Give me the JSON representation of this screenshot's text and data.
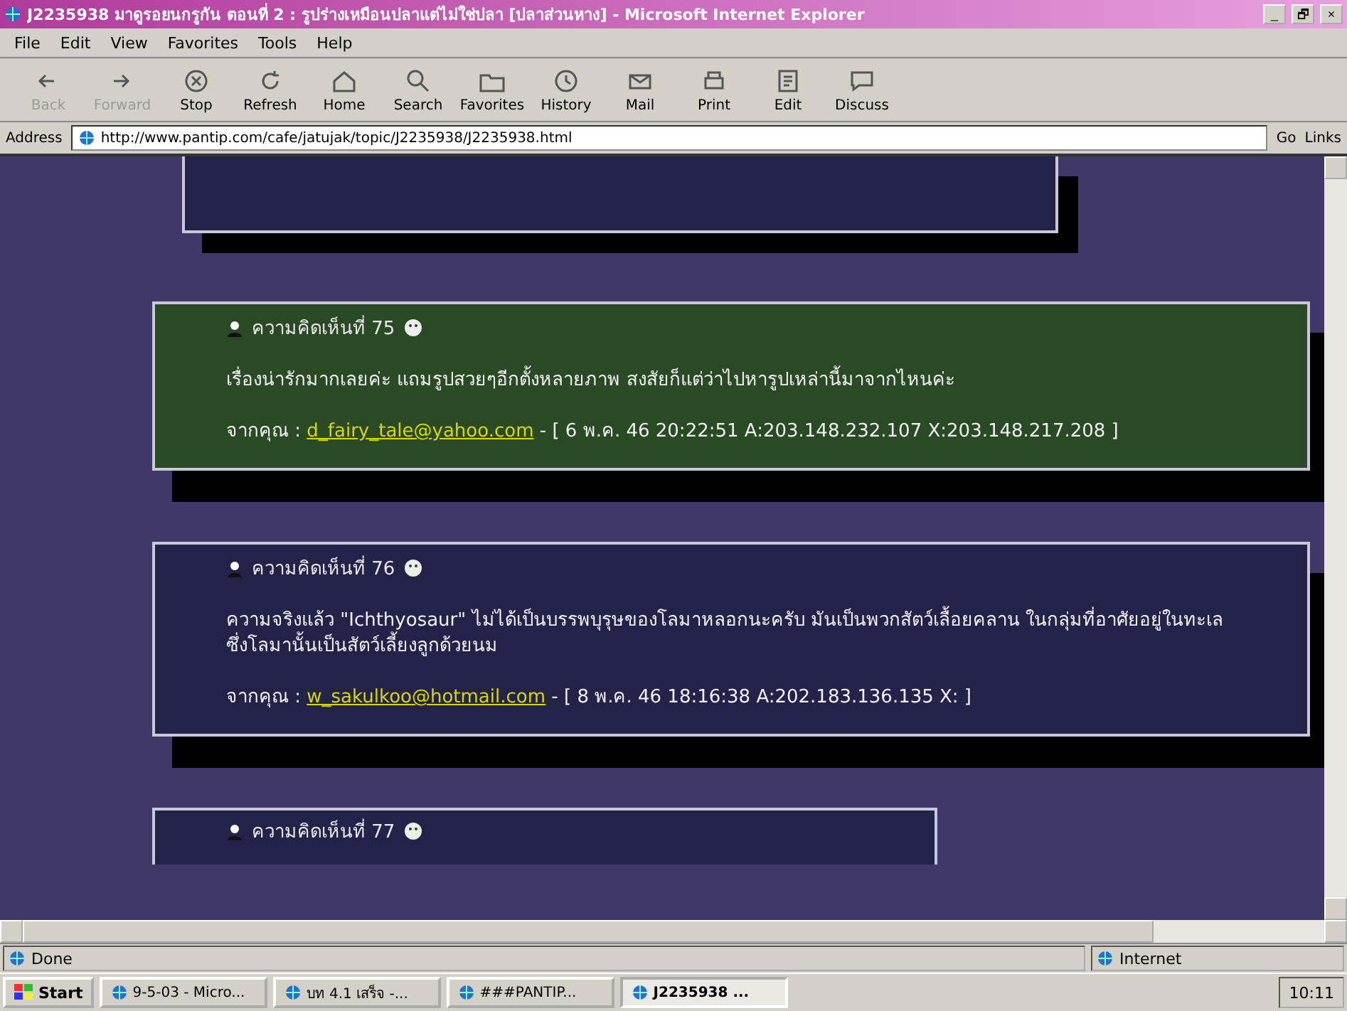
{
  "window": {
    "title": "J2235938 มาดูรอยนกรูกัน ตอนที่ 2 : รูปร่างเหมือนปลาแต่ไม่ใช่ปลา [ปลาส่วนหาง] - Microsoft Internet Explorer",
    "controls": [
      "_",
      "🗗",
      "×"
    ]
  },
  "menu": [
    "File",
    "Edit",
    "View",
    "Favorites",
    "Tools",
    "Help"
  ],
  "toolbar": [
    {
      "label": "Back",
      "kind": "back",
      "disabled": true
    },
    {
      "label": "Forward",
      "kind": "forward",
      "disabled": true
    },
    {
      "label": "Stop",
      "kind": "stop",
      "disabled": false
    },
    {
      "label": "Refresh",
      "kind": "refresh",
      "disabled": false
    },
    {
      "label": "Home",
      "kind": "home",
      "disabled": false
    },
    {
      "label": "Search",
      "kind": "search",
      "disabled": false
    },
    {
      "label": "Favorites",
      "kind": "favorites",
      "disabled": false
    },
    {
      "label": "History",
      "kind": "history",
      "disabled": false
    },
    {
      "label": "Mail",
      "kind": "mail",
      "disabled": false
    },
    {
      "label": "Print",
      "kind": "print",
      "disabled": false
    },
    {
      "label": "Edit",
      "kind": "edit",
      "disabled": false
    },
    {
      "label": "Discuss",
      "kind": "discuss",
      "disabled": false
    }
  ],
  "address": {
    "label": "Address",
    "value": "http://www.pantip.com/cafe/jatujak/topic/J2235938/J2235938.html",
    "go": "Go",
    "links": "Links"
  },
  "comments": [
    {
      "heading": "ความคิดเห็นที่ 75",
      "color": "#2a4a26",
      "body": "เรื่องน่ารักมากเลยค่ะ แถมรูปสวยๆอีกตั้งหลายภาพ สงสัยก็แต่ว่าไปหารูปเหล่านี้มาจากไหนค่ะ",
      "from": "จากคุณ :",
      "email": "d_fairy_tale@yahoo.com",
      "meta": "- [ 6 พ.ค. 46 20:22:51 A:203.148.232.107 X:203.148.217.208 ]"
    },
    {
      "heading": "ความคิดเห็นที่ 76",
      "color": "#23234a",
      "body": "ความจริงแล้ว \"Ichthyosaur\" ไม่ได้เป็นบรรพบุรุษของโลมาหลอกนะครับ มันเป็นพวกสัตว์เลื้อยคลาน ในกลุ่มที่อาศัยอยู่ในทะเล ซึ่งโลมานั้นเป็นสัตว์เลี้ยงลูกด้วยนม",
      "from": "จากคุณ :",
      "email": "w_sakulkoo@hotmail.com",
      "meta": "- [ 8 พ.ค. 46 18:16:38 A:202.183.136.135 X: ]"
    }
  ],
  "next_comment": {
    "heading": "ความคิดเห็นที่ 77"
  },
  "status_bar": {
    "text": "Done",
    "zone": "Internet"
  },
  "taskbar": {
    "start": "Start",
    "tasks": [
      {
        "label": "9-5-03 - Micro...",
        "selected": false
      },
      {
        "label": "บท 4.1 เสร็จ -...",
        "selected": false
      },
      {
        "label": "###PANTIP...",
        "selected": false
      },
      {
        "label": "J2235938 ...",
        "selected": true
      }
    ],
    "clock": "10:11"
  }
}
